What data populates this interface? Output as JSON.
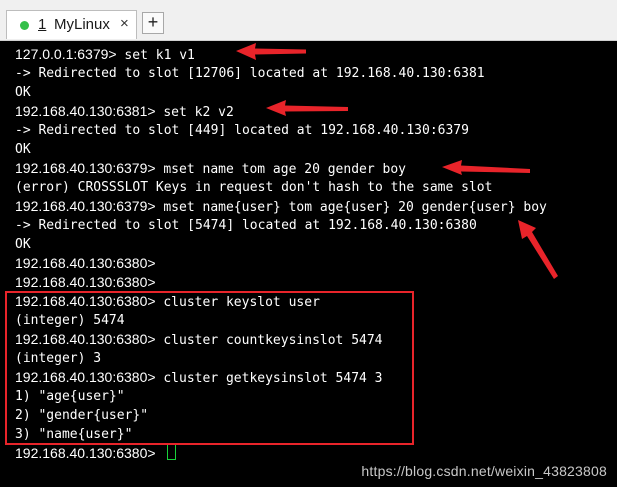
{
  "tab": {
    "index": "1",
    "title": "MyLinux",
    "close_glyph": "×",
    "status_color": "#35c04a"
  },
  "add_tab_label": "+",
  "terminal": {
    "lines": [
      {
        "prompt": "127.0.0.1:6379>",
        "text": " set k1 v1"
      },
      {
        "prompt": "",
        "text": "-> Redirected to slot [12706] located at 192.168.40.130:6381"
      },
      {
        "prompt": "",
        "text": "OK"
      },
      {
        "prompt": "192.168.40.130:6381>",
        "text": " set k2 v2"
      },
      {
        "prompt": "",
        "text": "-> Redirected to slot [449] located at 192.168.40.130:6379"
      },
      {
        "prompt": "",
        "text": "OK"
      },
      {
        "prompt": "192.168.40.130:6379>",
        "text": " mset name tom age 20 gender boy"
      },
      {
        "prompt": "",
        "text": "(error) CROSSSLOT Keys in request don't hash to the same slot"
      },
      {
        "prompt": "192.168.40.130:6379>",
        "text": " mset name{user} tom age{user} 20 gender{user} boy"
      },
      {
        "prompt": "",
        "text": "-> Redirected to slot [5474] located at 192.168.40.130:6380"
      },
      {
        "prompt": "",
        "text": "OK"
      },
      {
        "prompt": "192.168.40.130:6380>",
        "text": ""
      },
      {
        "prompt": "192.168.40.130:6380>",
        "text": ""
      },
      {
        "prompt": "192.168.40.130:6380>",
        "text": " cluster keyslot user"
      },
      {
        "prompt": "",
        "text": "(integer) 5474"
      },
      {
        "prompt": "192.168.40.130:6380>",
        "text": " cluster countkeysinslot 5474"
      },
      {
        "prompt": "",
        "text": "(integer) 3"
      },
      {
        "prompt": "192.168.40.130:6380>",
        "text": " cluster getkeysinslot 5474 3"
      },
      {
        "prompt": "",
        "text": "1) \"age{user}\""
      },
      {
        "prompt": "",
        "text": "2) \"gender{user}\""
      },
      {
        "prompt": "",
        "text": "3) \"name{user}\""
      },
      {
        "prompt": "192.168.40.130:6380>",
        "text": " "
      }
    ],
    "cursor_color": "#19d13a"
  },
  "annotation_color": "#e8242a",
  "watermark": "https://blog.csdn.net/weixin_43823808"
}
